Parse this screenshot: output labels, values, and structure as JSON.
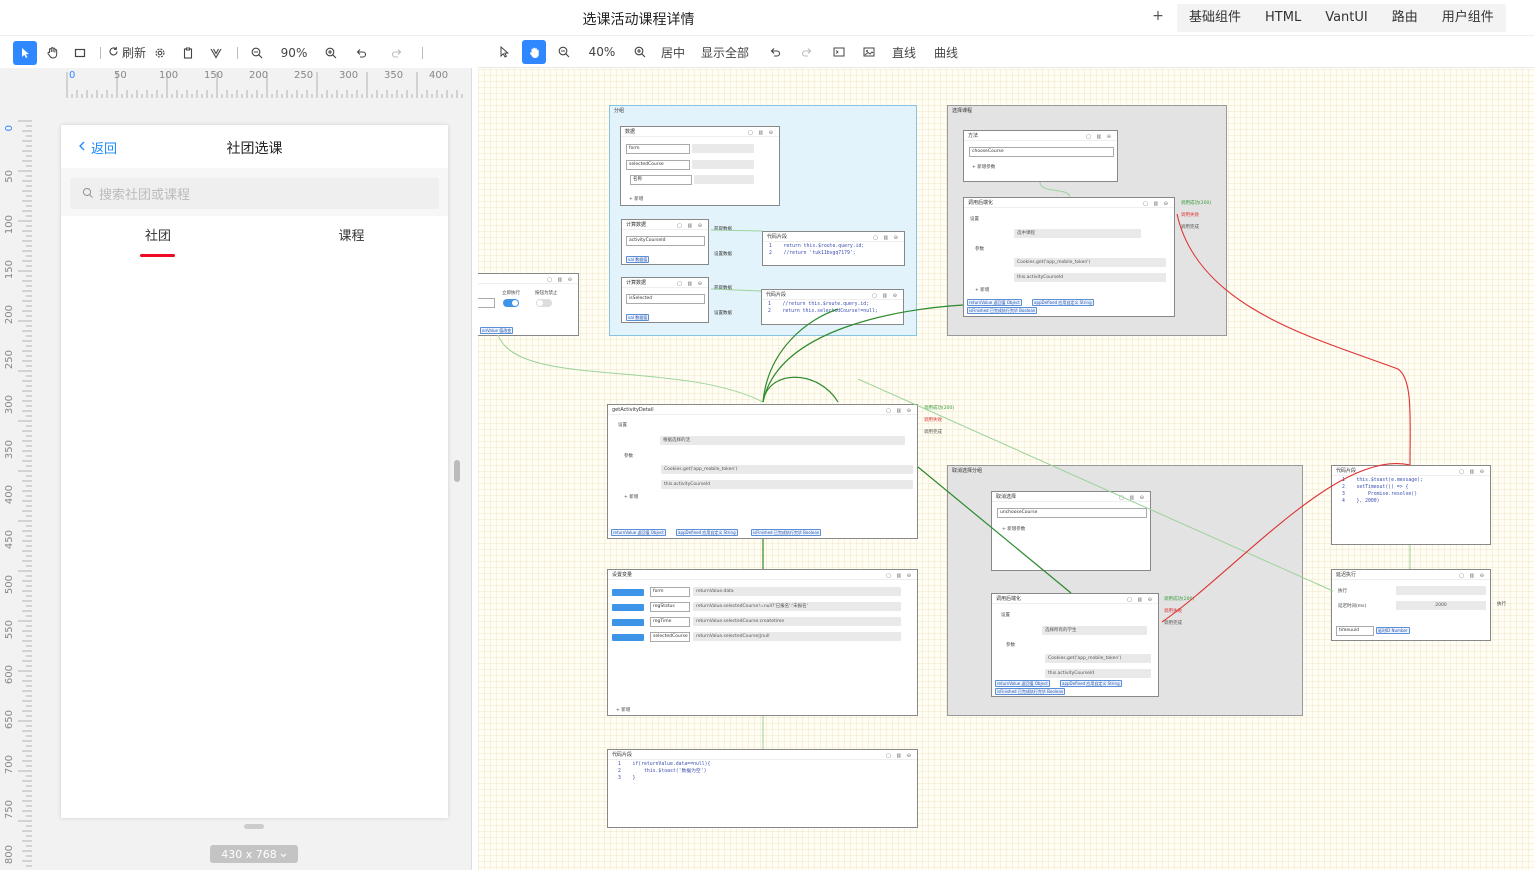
{
  "app": {
    "title": "选课活动课程详情",
    "plus": "+",
    "tabs": [
      "基础组件",
      "HTML",
      "VantUI",
      "路由",
      "用户组件"
    ]
  },
  "left_toolbar": {
    "refresh": "刷新",
    "zoom": "90%"
  },
  "right_toolbar": {
    "zoom": "40%",
    "center": "居中",
    "show_all": "显示全部",
    "straight": "直线",
    "curve": "曲线"
  },
  "ruler": {
    "h": [
      "0",
      "50",
      "100",
      "150",
      "200",
      "250",
      "300",
      "350",
      "400"
    ],
    "v": [
      "0",
      "50",
      "100",
      "150",
      "200",
      "250",
      "300",
      "350",
      "400",
      "450",
      "500",
      "550",
      "600",
      "650",
      "700",
      "750",
      "800"
    ]
  },
  "phone": {
    "back": "返回",
    "title": "社团选课",
    "search_placeholder": "搜索社团或课程",
    "tab_active": "社团",
    "tab_other": "课程",
    "size": "430 x 768"
  },
  "flow": {
    "g_branch": {
      "title": "分组",
      "data_title": "数据",
      "f1": "form",
      "f2": "selectedCourse",
      "f3": "名称",
      "add": "+ 新增",
      "calc1": "计算数据",
      "calc1_val": "activityCourseId",
      "calc1_chip": "val 数据值",
      "calc2": "计算数据",
      "calc2_val": "isSelected",
      "calc2_chip": "val 数据值",
      "get": "获取数据",
      "set": "设置数据",
      "code1_title": "代码片段",
      "code1": "1    return this.$route.query.id;\n2    //return 'tuk11bvgq7179';",
      "code2_title": "代码片段",
      "code2": "1    //return this.$route.query.id;\n2    return this.selectedCourse!=null;"
    },
    "left_node": {
      "t1": "立即执行",
      "t2": "按钮为禁止",
      "chip1": "onValue 值改变"
    },
    "g_select": {
      "title": "选择课程",
      "method": "方法",
      "method_val": "chooseCourse",
      "method_param": "+ 新增参数",
      "api": "调用后端化",
      "settings": "设置",
      "api_name": "选中课程",
      "params": "参数",
      "p1": "Cookies.get('app_mobile_token')",
      "p2": "this.activityCourseId",
      "add": "+ 新增",
      "chips": [
        "returnValue 返回值 Object",
        "appDefined 应用自定义 String",
        "isFinished 已完成执行完毕 Boolean"
      ],
      "outs": [
        "调用成功(200)",
        "调用失败",
        "调用完成"
      ]
    },
    "main_api": {
      "title": "getActivityDetail",
      "tag": "API",
      "settings": "设置",
      "api_name": "根据选择的活",
      "params": "参数",
      "p1": "Cookies.get('app_mobile_token')",
      "p2": "this.activityCourseId",
      "add": "+ 新增",
      "chips": [
        "returnValue 返回值 Object",
        "appDefined 应用自定义 String",
        "isFinished 已完成执行完毕 Boolean"
      ],
      "outs": [
        "调用成功(200)",
        "调用失败",
        "调用完成"
      ]
    },
    "set_vars": {
      "title": "设置变量",
      "rows": [
        {
          "k": "form",
          "v": "returnValue.data"
        },
        {
          "k": "regStatus",
          "v": "returnValue.selectedCourse!=null?'已报名':'未报名'"
        },
        {
          "k": "regTime",
          "v": "returnValue.selectedCourse.createtime"
        },
        {
          "k": "selectedCourse",
          "v": "returnValue.selectedCourse||null"
        }
      ],
      "add": "+ 新增"
    },
    "code_bottom": {
      "title": "代码片段",
      "code": "1    if(returnValue.data==null){\n2        this.$toast('数据为空')\n3    }"
    },
    "g_cancel": {
      "title": "取消选择分组",
      "method": "取消选择",
      "method_val": "unchooseCourse",
      "method_param": "+ 新增参数",
      "api": "调用后端化",
      "settings": "设置",
      "api_name": "选择所有的学生",
      "params": "参数",
      "p1": "Cookies.get('app_mobile_token')",
      "p2": "this.activityCourseId",
      "chips": [
        "returnValue 返回值 Object",
        "appDefined 应用自定义 String",
        "isFinished 已完成执行完毕 Boolean"
      ],
      "outs": [
        "调用成功(200)",
        "调用失败",
        "调用完成"
      ]
    },
    "code_right": {
      "title": "代码片段",
      "code": "1    this.$toast(e.message);\n2    setTimeout(() => {\n3        Promise.resolve()\n4    }, 2000)"
    },
    "delay": {
      "title": "延迟执行",
      "l1": "执行",
      "l2": "延迟时间(ms)",
      "val": "2000",
      "chip1": "timeuuid",
      "chip2": "延时ID Number",
      "out": "执行"
    }
  }
}
